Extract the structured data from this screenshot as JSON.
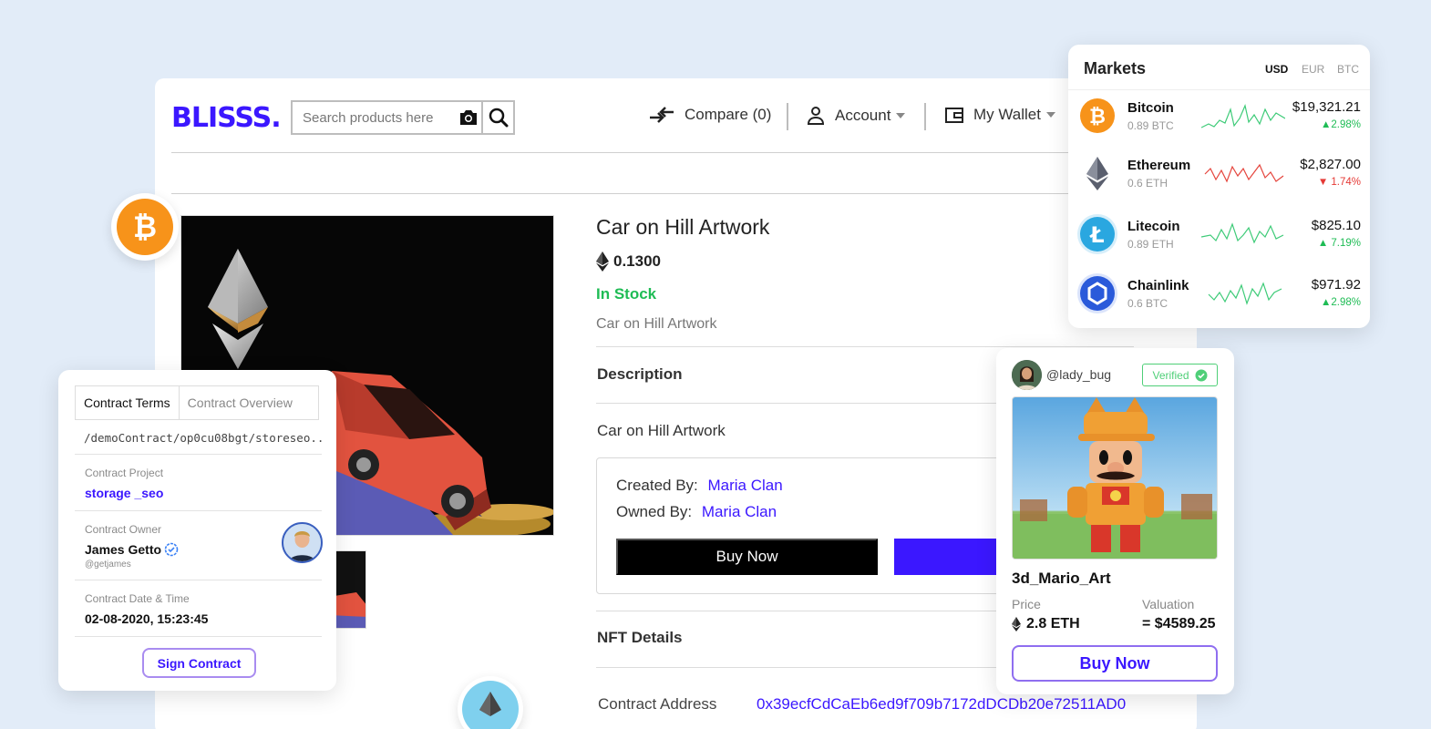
{
  "header": {
    "logo": "BLISSS.",
    "search_placeholder": "Search products here",
    "compare_label": "Compare (0)",
    "account_label": "Account",
    "wallet_label": "My Wallet"
  },
  "product": {
    "title": "Car on Hill Artwork",
    "price": "0.1300",
    "stock": "In Stock",
    "subtitle": "Car on Hill Artwork",
    "description_heading": "Description",
    "description_text": "Car on Hill Artwork",
    "created_by_label": "Created By:",
    "created_by": "Maria Clan",
    "owned_by_label": "Owned By:",
    "owned_by": "Maria Clan",
    "buy_now_label": "Buy Now",
    "nft_details_heading": "NFT Details",
    "contract_address_label": "Contract Address",
    "contract_address": "0x39ecfCdCaEb6ed9f709b7172dDCDb20e72511AD0"
  },
  "contract": {
    "tabs": [
      "Contract Terms",
      "Contract Overview"
    ],
    "path": "/demoContract/op0cu08bgt/storeseo..",
    "project_label": "Contract Project",
    "project_value": "storage _seo",
    "owner_label": "Contract Owner",
    "owner_name": "James Getto",
    "owner_handle": "@getjames",
    "date_label": "Contract Date & Time",
    "date_value": "02-08-2020, 15:23:45",
    "sign_label": "Sign Contract"
  },
  "markets": {
    "title": "Markets",
    "currencies": [
      "USD",
      "EUR",
      "BTC"
    ],
    "active_currency": "USD",
    "rows": [
      {
        "name": "Bitcoin",
        "amount": "0.89 BTC",
        "price": "$19,321.21",
        "change": "2.98%",
        "direction": "up",
        "color": "#f7931a"
      },
      {
        "name": "Ethereum",
        "amount": "0.6  ETH",
        "price": "$2,827.00",
        "change": "1.74%",
        "direction": "down",
        "color": "#e53935"
      },
      {
        "name": "Litecoin",
        "amount": "0.89 ETH",
        "price": "$825.10",
        "change": "7.19%",
        "direction": "up",
        "color": "#2aa7e0"
      },
      {
        "name": "Chainlink",
        "amount": "0.6 BTC",
        "price": "$971.92",
        "change": "2.98%",
        "direction": "up",
        "color": "#2a5ada"
      }
    ]
  },
  "nft": {
    "handle": "@lady_bug",
    "verified_label": "Verified",
    "title": "3d_Mario_Art",
    "price_label": "Price",
    "price_value": "2.8 ETH",
    "valuation_label": "Valuation",
    "valuation_value": "= $4589.25",
    "buy_label": "Buy Now"
  },
  "colors": {
    "brand": "#3b17ff",
    "up": "#1fbc55",
    "down": "#e53935",
    "background": "#e2ecf8"
  }
}
